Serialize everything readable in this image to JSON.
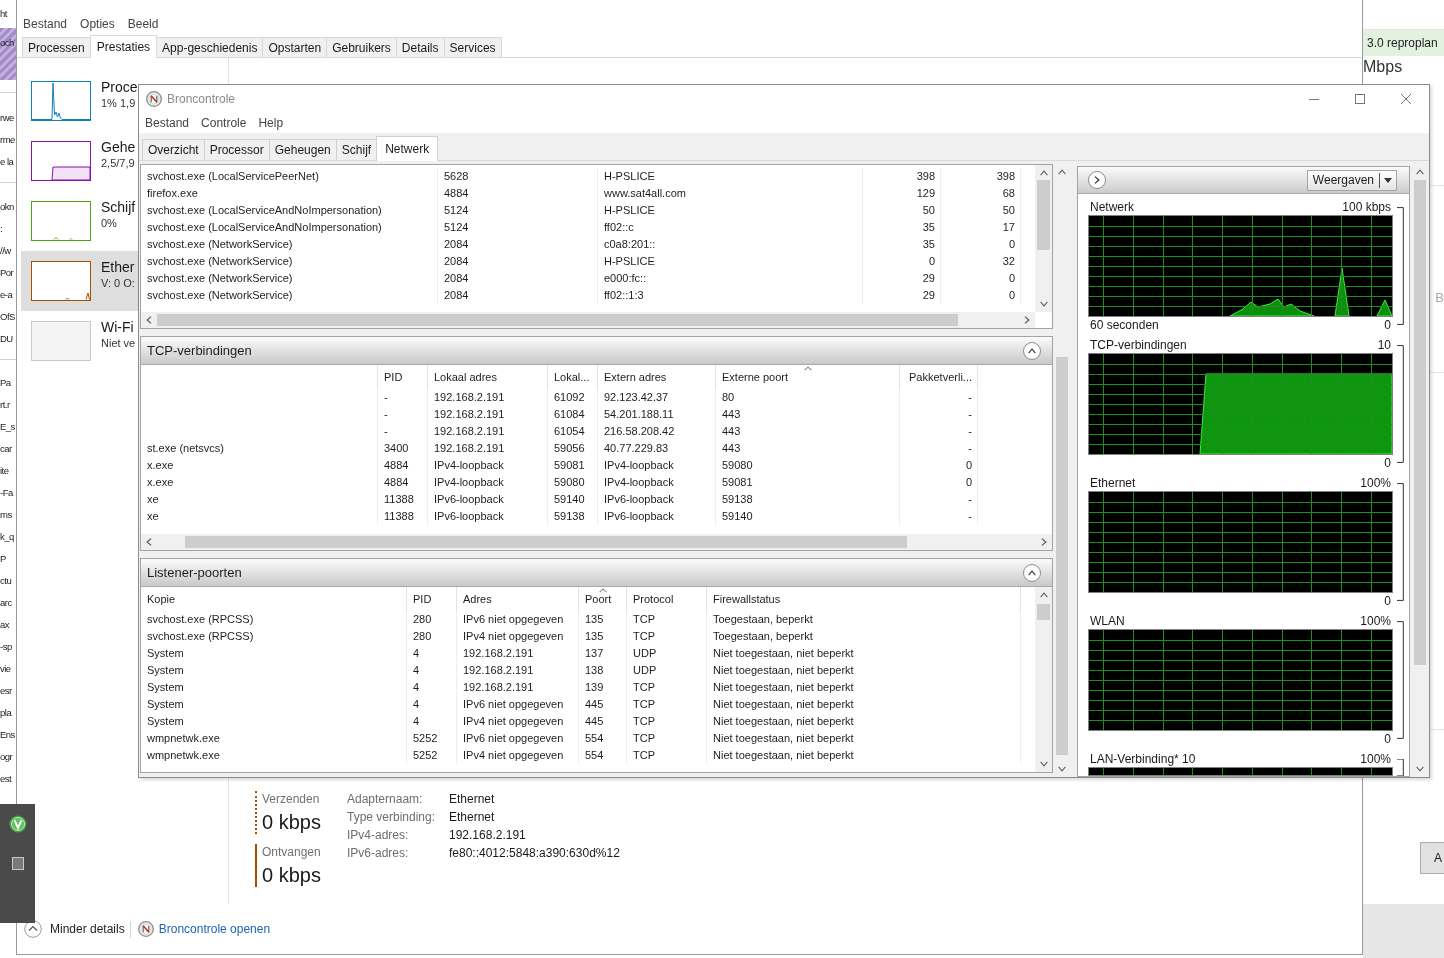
{
  "background_left": {
    "top_text": "ht",
    "banner_text": "och",
    "groups": [
      [
        "rwe",
        "rme",
        "e la"
      ],
      [
        "okn",
        ":",
        "//w",
        "Por",
        "e-a",
        "OfS",
        "DU"
      ],
      [
        "Pa",
        "rt.r",
        "E_s",
        "car",
        "ite",
        "-Fa",
        "ms",
        "k_q",
        "P",
        "ctu",
        "arc",
        "ax",
        "-sp",
        "vie",
        "esr",
        "pla",
        "Ens",
        "ogr",
        "est"
      ]
    ]
  },
  "background_right": {
    "banner_text": "3.0 reproplan",
    "speed": "Mbps",
    "side_letter": "B",
    "button_label": "A"
  },
  "task_manager": {
    "menu": [
      "Bestand",
      "Opties",
      "Beeld"
    ],
    "tabs": [
      {
        "label": "Processen",
        "selected": false
      },
      {
        "label": "Prestaties",
        "selected": true
      },
      {
        "label": "App-geschiedenis",
        "selected": false
      },
      {
        "label": "Opstarten",
        "selected": false
      },
      {
        "label": "Gebruikers",
        "selected": false
      },
      {
        "label": "Details",
        "selected": false
      },
      {
        "label": "Services",
        "selected": false
      }
    ],
    "resources": [
      {
        "name": "Proce",
        "reading": "1% 1,9",
        "color": "#117dbb",
        "kind": "spike",
        "selected": false
      },
      {
        "name": "Gehe",
        "reading": "2,5/7,9",
        "color": "#8b12ae",
        "kind": "step",
        "selected": false
      },
      {
        "name": "Schijf",
        "reading": "0%",
        "color": "#4da60c",
        "kind": "flat",
        "selected": false
      },
      {
        "name": "Ether",
        "reading": "V: 0 O:",
        "color": "#a74f01",
        "kind": "blip",
        "selected": true
      },
      {
        "name": "Wi-Fi",
        "reading": "Niet ve",
        "color": "#c8c8c8",
        "kind": "empty",
        "selected": false
      }
    ],
    "throughput": [
      {
        "label": "Verzenden",
        "value": "0 kbps",
        "kind": "dotted"
      },
      {
        "label": "Ontvangen",
        "value": "0 kbps",
        "kind": "solid"
      }
    ],
    "properties": [
      {
        "label": "Adapternaam:",
        "value": "Ethernet"
      },
      {
        "label": "Type verbinding:",
        "value": "Ethernet"
      },
      {
        "label": "IPv4-adres:",
        "value": "192.168.2.191"
      },
      {
        "label": "IPv6-adres:",
        "value": "fe80::4012:5848:a390:630d%12"
      }
    ],
    "footer": {
      "details_button": "Minder details",
      "monitor_link": "Broncontrole openen"
    }
  },
  "resource_monitor": {
    "title": "Broncontrole",
    "menu": [
      "Bestand",
      "Controle",
      "Help"
    ],
    "tabs": [
      {
        "label": "Overzicht",
        "selected": false
      },
      {
        "label": "Processor",
        "selected": false
      },
      {
        "label": "Geheugen",
        "selected": false
      },
      {
        "label": "Schijf",
        "selected": false
      },
      {
        "label": "Netwerk",
        "selected": true
      }
    ],
    "activity": {
      "rows": [
        [
          "svchost.exe (LocalServicePeerNet)",
          "5628",
          "H-PSLICE",
          "398",
          "398"
        ],
        [
          "firefox.exe",
          "4884",
          "www.sat4all.com",
          "129",
          "68"
        ],
        [
          "svchost.exe (LocalServiceAndNoImpersonation)",
          "5124",
          "H-PSLICE",
          "50",
          "50"
        ],
        [
          "svchost.exe (LocalServiceAndNoImpersonation)",
          "5124",
          "ff02::c",
          "35",
          "17"
        ],
        [
          "svchost.exe (NetworkService)",
          "2084",
          "c0a8:201::",
          "35",
          "0"
        ],
        [
          "svchost.exe (NetworkService)",
          "2084",
          "H-PSLICE",
          "0",
          "32"
        ],
        [
          "svchost.exe (NetworkService)",
          "2084",
          "e000:fc::",
          "29",
          "0"
        ],
        [
          "svchost.exe (NetworkService)",
          "2084",
          "ff02::1:3",
          "29",
          "0"
        ]
      ]
    },
    "tcp_connections": {
      "title": "TCP-verbindingen",
      "expanded": true,
      "columns": [
        {
          "label": "PID",
          "sorted": false
        },
        {
          "label": "Lokaal adres",
          "sorted": false
        },
        {
          "label": "Lokal...",
          "sorted": false
        },
        {
          "label": "Extern adres",
          "sorted": false
        },
        {
          "label": "Externe poort",
          "sorted": true
        },
        {
          "label": "Pakketverli...",
          "sorted": false
        }
      ],
      "rows": [
        {
          "cells": [
            "-",
            "192.168.2.191",
            "61092",
            "92.123.42.37",
            "80",
            "-"
          ]
        },
        {
          "cells": [
            "-",
            "192.168.2.191",
            "61084",
            "54.201.188.11",
            "443",
            "-"
          ]
        },
        {
          "cells": [
            "-",
            "192.168.2.191",
            "61054",
            "216.58.208.42",
            "443",
            "-"
          ]
        },
        {
          "column_1": "st.exe (netsvcs)",
          "cells": [
            "3400",
            "192.168.2.191",
            "59056",
            "40.77.229.83",
            "443",
            "-"
          ]
        },
        {
          "column_1": "x.exe",
          "cells": [
            "4884",
            "IPv4-loopback",
            "59081",
            "IPv4-loopback",
            "59080",
            "0"
          ]
        },
        {
          "column_1": "x.exe",
          "cells": [
            "4884",
            "IPv4-loopback",
            "59080",
            "IPv4-loopback",
            "59081",
            "0"
          ]
        },
        {
          "column_1": "xe",
          "cells": [
            "11388",
            "IPv6-loopback",
            "59140",
            "IPv6-loopback",
            "59138",
            "-"
          ]
        },
        {
          "column_1": "xe",
          "cells": [
            "11388",
            "IPv6-loopback",
            "59138",
            "IPv6-loopback",
            "59140",
            "-"
          ]
        }
      ]
    },
    "listening_ports": {
      "title": "Listener-poorten",
      "expanded": true,
      "columns": [
        {
          "label": "Kopie",
          "sorted": false
        },
        {
          "label": "PID",
          "sorted": false
        },
        {
          "label": "Adres",
          "sorted": false
        },
        {
          "label": "Poort",
          "sorted": true
        },
        {
          "label": "Protocol",
          "sorted": false
        },
        {
          "label": "Firewallstatus",
          "sorted": false
        }
      ],
      "rows": [
        [
          "svchost.exe (RPCSS)",
          "280",
          "IPv6 niet opgegeven",
          "135",
          "TCP",
          "Toegestaan, beperkt"
        ],
        [
          "svchost.exe (RPCSS)",
          "280",
          "IPv4 niet opgegeven",
          "135",
          "TCP",
          "Toegestaan, beperkt"
        ],
        [
          "System",
          "4",
          "192.168.2.191",
          "137",
          "UDP",
          "Niet toegestaan, niet beperkt"
        ],
        [
          "System",
          "4",
          "192.168.2.191",
          "138",
          "UDP",
          "Niet toegestaan, niet beperkt"
        ],
        [
          "System",
          "4",
          "192.168.2.191",
          "139",
          "TCP",
          "Niet toegestaan, niet beperkt"
        ],
        [
          "System",
          "4",
          "IPv6 niet opgegeven",
          "445",
          "TCP",
          "Niet toegestaan, niet beperkt"
        ],
        [
          "System",
          "4",
          "IPv4 niet opgegeven",
          "445",
          "TCP",
          "Niet toegestaan, niet beperkt"
        ],
        [
          "wmpnetwk.exe",
          "5252",
          "IPv6 niet opgegeven",
          "554",
          "TCP",
          "Niet toegestaan, niet beperkt"
        ],
        [
          "wmpnetwk.exe",
          "5252",
          "IPv4 niet opgegeven",
          "554",
          "TCP",
          "Niet toegestaan, niet beperkt"
        ]
      ]
    },
    "graphs_panel": {
      "views_button": "Weergaven",
      "graphs": [
        {
          "kind": "traffic",
          "label": "Netwerk",
          "max": "100 kbps",
          "time_span": "60 seconden",
          "min": "0"
        },
        {
          "kind": "plateau",
          "label": "TCP-verbindingen",
          "max": "10",
          "min": "0"
        },
        {
          "kind": "idle",
          "label": "Ethernet",
          "max": "100%",
          "min": "0"
        },
        {
          "kind": "idle",
          "label": "WLAN",
          "max": "100%",
          "min": "0"
        },
        {
          "kind": "idle",
          "label": "LAN-Verbinding* 10",
          "max": "100%"
        }
      ]
    }
  }
}
